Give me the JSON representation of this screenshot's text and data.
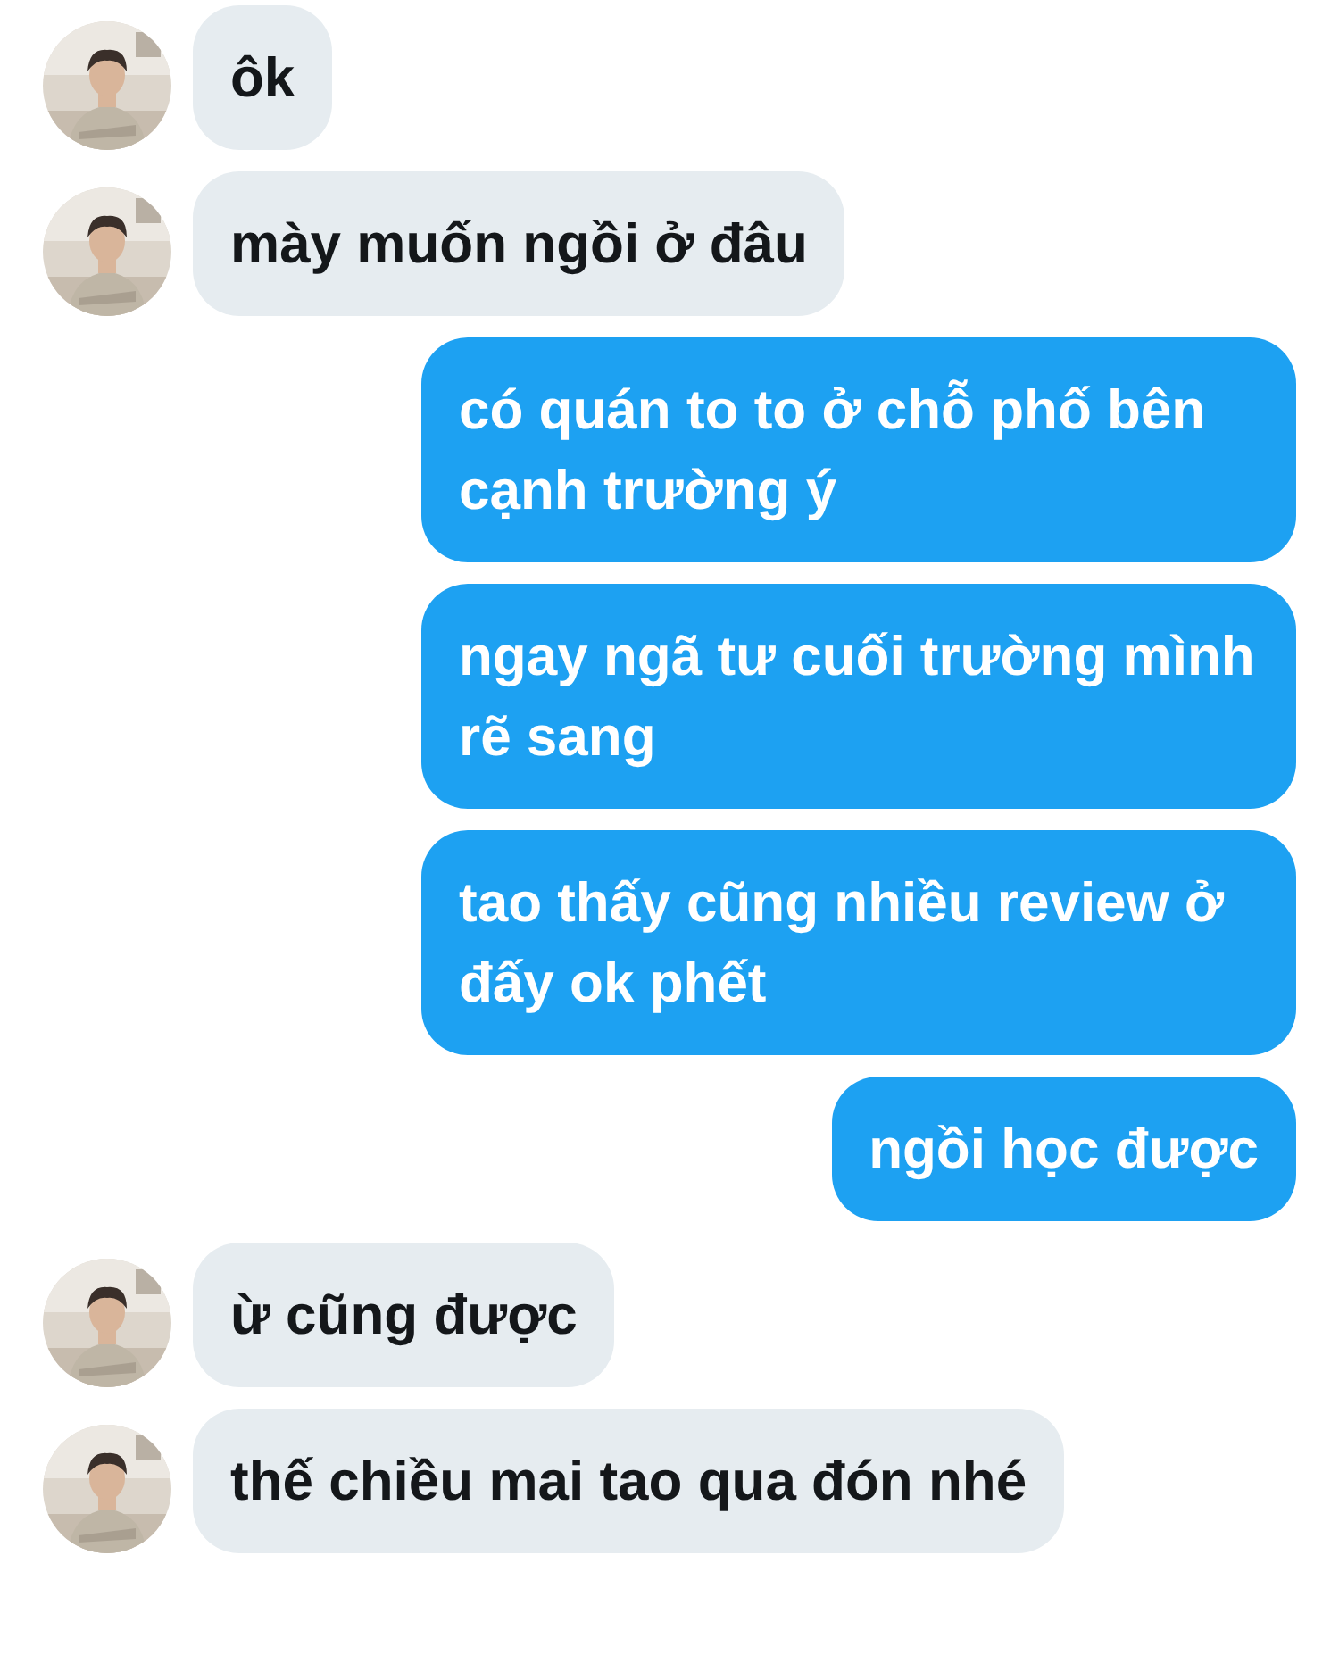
{
  "messages": [
    {
      "kind": "incoming",
      "text": "ôk"
    },
    {
      "kind": "incoming",
      "text": "mày muốn ngồi ở đâu"
    },
    {
      "kind": "outgoing",
      "text": "có quán to to ở chỗ phố bên cạnh trường ý"
    },
    {
      "kind": "outgoing",
      "text": "ngay ngã tư cuối trường mình rẽ sang"
    },
    {
      "kind": "outgoing",
      "text": "tao thấy cũng nhiều review ở đấy ok phết"
    },
    {
      "kind": "outgoing",
      "text": "ngồi học được"
    },
    {
      "kind": "incoming",
      "text": "ừ cũng được"
    },
    {
      "kind": "incoming",
      "text": "thế chiều mai tao qua đón nhé"
    }
  ]
}
